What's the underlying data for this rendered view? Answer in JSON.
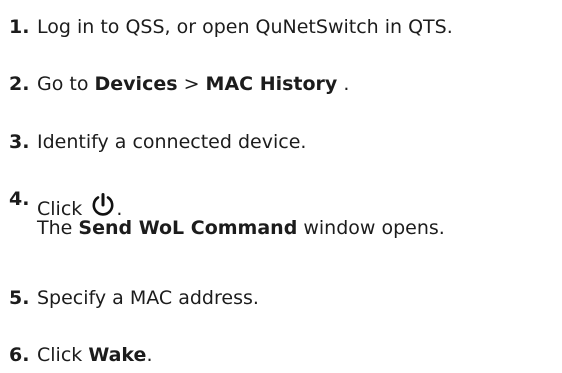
{
  "steps": [
    {
      "number": "1.",
      "text": "Log in to QSS, or open QuNetSwitch in QTS."
    },
    {
      "number": "2.",
      "prefix": "Go to ",
      "bold1": "Devices",
      "sep": " > ",
      "bold2": "MAC History",
      "suffix": " ."
    },
    {
      "number": "3.",
      "text": "Identify a connected device."
    },
    {
      "number": "4.",
      "prefix": "Click ",
      "icon": "power-icon",
      "suffix": ".",
      "line2_prefix": "The ",
      "line2_bold": "Send WoL Command",
      "line2_suffix": " window opens."
    },
    {
      "number": "5.",
      "text": "Specify a MAC address."
    },
    {
      "number": "6.",
      "prefix": "Click ",
      "bold": "Wake",
      "suffix": "."
    }
  ]
}
